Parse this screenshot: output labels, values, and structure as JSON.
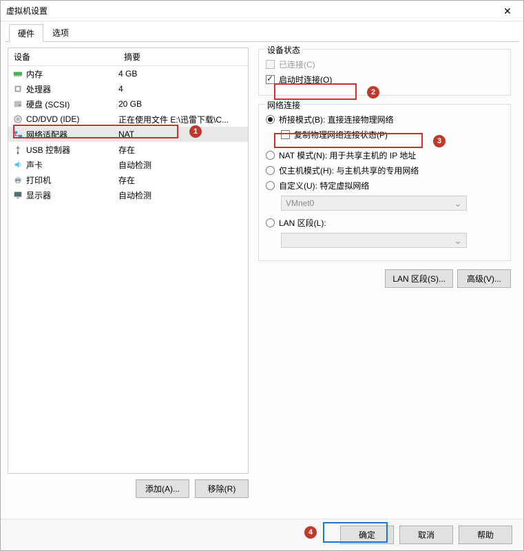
{
  "window": {
    "title": "虚拟机设置"
  },
  "tabs": {
    "hardware": "硬件",
    "options": "选项"
  },
  "device_list": {
    "col_device": "设备",
    "col_summary": "摘要",
    "rows": [
      {
        "icon": "memory",
        "name": "内存",
        "summary": "4 GB"
      },
      {
        "icon": "cpu",
        "name": "处理器",
        "summary": "4"
      },
      {
        "icon": "disk",
        "name": "硬盘 (SCSI)",
        "summary": "20 GB"
      },
      {
        "icon": "cd",
        "name": "CD/DVD (IDE)",
        "summary": "正在使用文件 E:\\迅雷下载\\C..."
      },
      {
        "icon": "net",
        "name": "网络适配器",
        "summary": "NAT",
        "selected": true
      },
      {
        "icon": "usb",
        "name": "USB 控制器",
        "summary": "存在"
      },
      {
        "icon": "sound",
        "name": "声卡",
        "summary": "自动检测"
      },
      {
        "icon": "printer",
        "name": "打印机",
        "summary": "存在"
      },
      {
        "icon": "display",
        "name": "显示器",
        "summary": "自动检测"
      }
    ]
  },
  "left_buttons": {
    "add": "添加(A)...",
    "remove": "移除(R)"
  },
  "device_status": {
    "title": "设备状态",
    "connected": "已连接(C)",
    "connect_at_power_on": "启动时连接(O)"
  },
  "network": {
    "title": "网络连接",
    "bridged": "桥接模式(B): 直接连接物理网络",
    "replicate": "复制物理网络连接状态(P)",
    "nat": "NAT 模式(N): 用于共享主机的 IP 地址",
    "hostonly": "仅主机模式(H): 与主机共享的专用网络",
    "custom": "自定义(U): 特定虚拟网络",
    "custom_value": "VMnet0",
    "lan": "LAN 区段(L):",
    "lan_value": ""
  },
  "right_buttons": {
    "lan_segments": "LAN 区段(S)...",
    "advanced": "高级(V)..."
  },
  "footer": {
    "ok": "确定",
    "cancel": "取消",
    "help": "帮助"
  },
  "callouts": {
    "c1": "1",
    "c2": "2",
    "c3": "3",
    "c4": "4"
  }
}
